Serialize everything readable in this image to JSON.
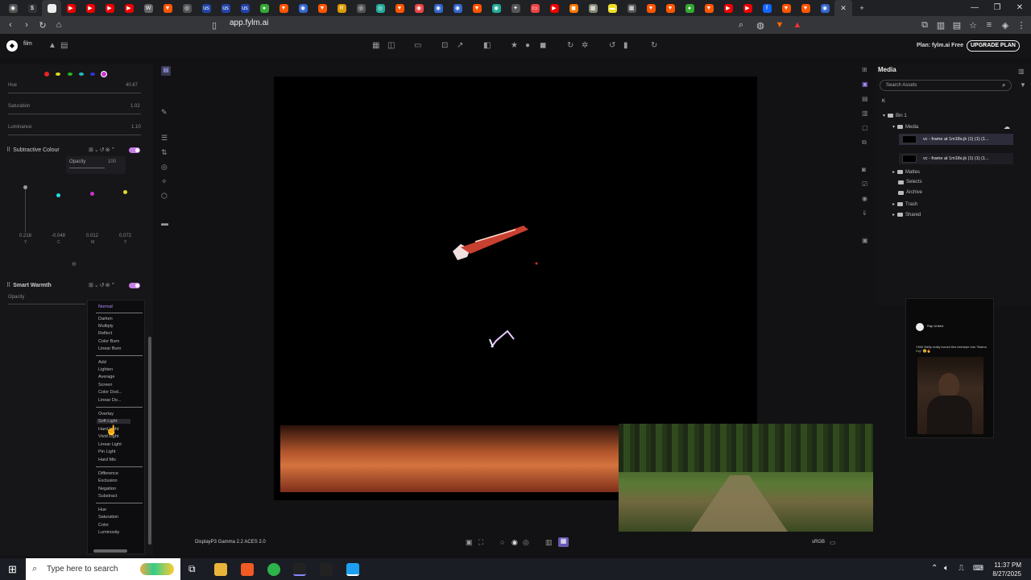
{
  "browser": {
    "url": "app.fylm.ai",
    "tab_labels": [
      "R",
      "",
      ""
    ],
    "window_controls": [
      "—",
      "❐",
      "✕"
    ]
  },
  "app": {
    "project_name": "film",
    "plan_text": "Plan: fylm.ai Free",
    "upgrade_label": "UPGRADE PLAN"
  },
  "left": {
    "hue_label": "Hue",
    "hue_value": "40.67",
    "saturation_label": "Saturation",
    "saturation_value": "1.02",
    "luminance_label": "Luminance",
    "luminance_value": "1.10",
    "subtractive_title": "Subtractive Colour",
    "subtractive_opacity_label": "Opacity",
    "subtractive_opacity_value": "100",
    "ycmy_values": [
      "0.218",
      "-0.048",
      "0.012",
      "0.072"
    ],
    "ycmy_letters": [
      "Y",
      "C",
      "M",
      "Y"
    ],
    "warmth_title": "Smart Warmth",
    "warmth_opacity_label": "Opacity"
  },
  "blend_modes": {
    "selected": "Normal",
    "groups": [
      [
        "Normal"
      ],
      [
        "Darken",
        "Multiply",
        "Reflect",
        "Color Burn",
        "Linear Burn"
      ],
      [
        "Add",
        "Lighten",
        "Average",
        "Screen",
        "Color Dod...",
        "Linear Do..."
      ],
      [
        "Overlay",
        "Soft Light",
        "Hard Light",
        "Vivid Light",
        "Linear Light",
        "Pin Light",
        "Hard Mix"
      ],
      [
        "Difference",
        "Exclusion",
        "Negation",
        "Substract"
      ],
      [
        "Hue",
        "Saturation",
        "Color",
        "Luminosity"
      ]
    ]
  },
  "media": {
    "title": "Media",
    "search_placeholder": "Search Assets",
    "k_label": "K",
    "bin": "Bin 1",
    "media_folder": "Media",
    "clips": [
      "vc - frame at 1m18s.jk (1) (1) (1...",
      "vc - frame at 1m18s.jk (1) (1) (1..."
    ],
    "folders": [
      "Mattes",
      "Selects",
      "Archive",
      "Trash",
      "Shared"
    ]
  },
  "phone_preview": {
    "name": "Rap United",
    "caption": "YNW Melly really turned this freestyle into \"Mama Cry\" 😢🔥"
  },
  "bottom": {
    "colorspace": "DisplayP3 Gamma 2.2 ACES 2.0",
    "output": "sRGB"
  },
  "taskbar": {
    "search_placeholder": "Type here to search",
    "time": "11:37 PM",
    "date": "8/27/2025"
  }
}
